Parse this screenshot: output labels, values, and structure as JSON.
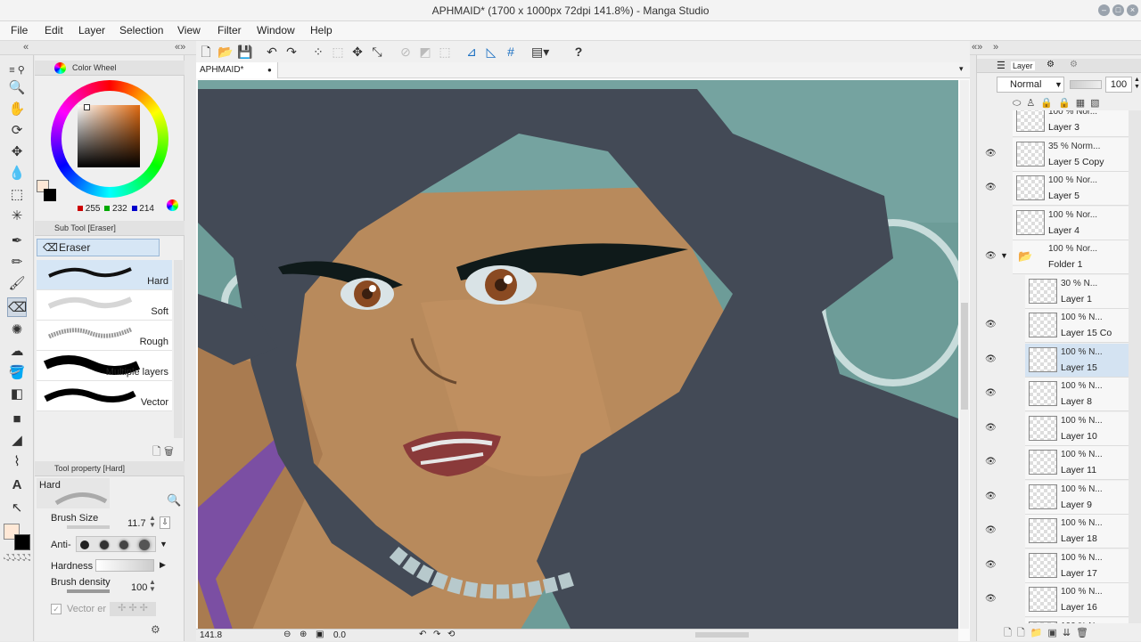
{
  "window": {
    "title": "APHMAID* (1700 x 1000px 72dpi 141.8%)  - Manga Studio"
  },
  "menu": [
    "File",
    "Edit",
    "Layer",
    "Selection",
    "View",
    "Filter",
    "Window",
    "Help"
  ],
  "document_tab": {
    "label": "APHMAID*"
  },
  "color_wheel": {
    "title": "Color Wheel",
    "r": "255",
    "g": "232",
    "b": "214",
    "main_color": "#ffe8d6",
    "sub_color": "#000000"
  },
  "sub_tool": {
    "title": "Sub Tool [Eraser]",
    "group": "Eraser",
    "brushes": [
      {
        "label": "Hard",
        "selected": true
      },
      {
        "label": "Soft",
        "selected": false
      },
      {
        "label": "Rough",
        "selected": false
      },
      {
        "label": "Multiple layers",
        "selected": false
      },
      {
        "label": "Vector",
        "selected": false
      }
    ]
  },
  "tool_property": {
    "title": "Tool property [Hard]",
    "preset": "Hard",
    "brush_size_label": "Brush Size",
    "brush_size_value": "11.7",
    "anti_label": "Anti-",
    "hardness_label": "Hardness",
    "density_label": "Brush density",
    "density_value": "100",
    "vector_label": "Vector er"
  },
  "layer_panel": {
    "title": "Layer",
    "blend_mode": "Normal",
    "opacity": "100",
    "layers": [
      {
        "pct": "100 %  Nor...",
        "name": "Layer 3",
        "visible": false,
        "selected": false,
        "indent": 0
      },
      {
        "pct": "35 %  Norm...",
        "name": "Layer 5 Copy",
        "visible": true,
        "selected": false,
        "indent": 0
      },
      {
        "pct": "100 %  Nor...",
        "name": "Layer 5",
        "visible": true,
        "selected": false,
        "indent": 0
      },
      {
        "pct": "100 %  Nor...",
        "name": "Layer 4",
        "visible": false,
        "selected": false,
        "indent": 0
      },
      {
        "pct": "100 %  Nor...",
        "name": "Folder 1",
        "visible": true,
        "selected": false,
        "indent": 0,
        "folder": true
      },
      {
        "pct": "30 %   N...",
        "name": "Layer 1",
        "visible": false,
        "selected": false,
        "indent": 1
      },
      {
        "pct": "100 %  N...",
        "name": "Layer 15 Co",
        "visible": true,
        "selected": false,
        "indent": 1
      },
      {
        "pct": "100 %  N...",
        "name": "Layer 15",
        "visible": true,
        "selected": true,
        "indent": 1
      },
      {
        "pct": "100 %  N...",
        "name": "Layer 8",
        "visible": true,
        "selected": false,
        "indent": 1
      },
      {
        "pct": "100 %  N...",
        "name": "Layer 10",
        "visible": true,
        "selected": false,
        "indent": 1
      },
      {
        "pct": "100 %  N...",
        "name": "Layer 11",
        "visible": true,
        "selected": false,
        "indent": 1
      },
      {
        "pct": "100 %  N...",
        "name": "Layer 9",
        "visible": true,
        "selected": false,
        "indent": 1
      },
      {
        "pct": "100 %  N...",
        "name": "Layer 18",
        "visible": true,
        "selected": false,
        "indent": 1
      },
      {
        "pct": "100 %  N...",
        "name": "Layer 17",
        "visible": true,
        "selected": false,
        "indent": 1
      },
      {
        "pct": "100 %  N...",
        "name": "Layer 16",
        "visible": true,
        "selected": false,
        "indent": 1
      },
      {
        "pct": "100 %  N...",
        "name": "",
        "visible": false,
        "selected": false,
        "indent": 1
      }
    ]
  },
  "status": {
    "zoom": "141.8",
    "rotation": "0.0"
  },
  "colors": {
    "hair": "#434a56",
    "skin": "#b88a5c",
    "background": "#6d9c98",
    "accent": "#7b4fa3"
  }
}
